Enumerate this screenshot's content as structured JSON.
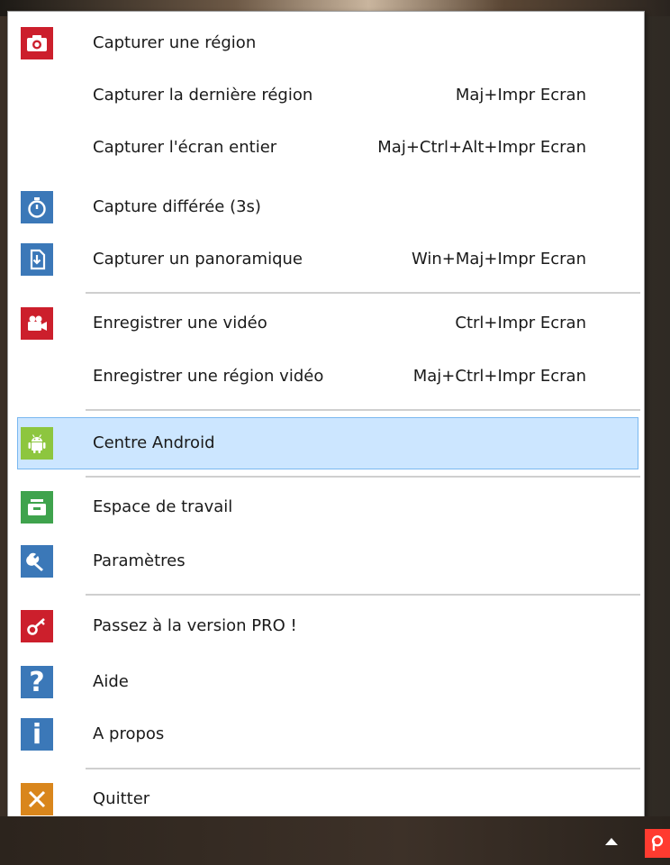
{
  "menu": {
    "items": [
      {
        "label": "Capturer une région",
        "shortcut": "",
        "icon": "camera-icon",
        "icon_bg": "#cc1f2c"
      },
      {
        "label": "Capturer la dernière région",
        "shortcut": "Maj+Impr Ecran",
        "icon": "",
        "icon_bg": ""
      },
      {
        "label": "Capturer l'écran entier",
        "shortcut": "Maj+Ctrl+Alt+Impr Ecran",
        "icon": "",
        "icon_bg": ""
      },
      {
        "label": "Capture différée (3s)",
        "shortcut": "",
        "icon": "stopwatch-icon",
        "icon_bg": "#3b78b8"
      },
      {
        "label": "Capturer un panoramique",
        "shortcut": "Win+Maj+Impr Ecran",
        "icon": "panorama-icon",
        "icon_bg": "#3b78b8"
      },
      {
        "label": "Enregistrer une vidéo",
        "shortcut": "Ctrl+Impr Ecran",
        "icon": "video-camera-icon",
        "icon_bg": "#cc1f2c"
      },
      {
        "label": "Enregistrer une région vidéo",
        "shortcut": "Maj+Ctrl+Impr Ecran",
        "icon": "",
        "icon_bg": ""
      },
      {
        "label": "Centre Android",
        "shortcut": "",
        "icon": "android-icon",
        "icon_bg": "#8dc63f",
        "selected": true
      },
      {
        "label": "Espace de travail",
        "shortcut": "",
        "icon": "workspace-icon",
        "icon_bg": "#3fa34d"
      },
      {
        "label": "Paramètres",
        "shortcut": "",
        "icon": "wrench-icon",
        "icon_bg": "#3b78b8"
      },
      {
        "label": "Passez à la version PRO !",
        "shortcut": "",
        "icon": "key-icon",
        "icon_bg": "#cc1f2c"
      },
      {
        "label": "Aide",
        "shortcut": "",
        "icon": "question-icon",
        "icon_bg": "#3b78b8"
      },
      {
        "label": "A propos",
        "shortcut": "",
        "icon": "info-icon",
        "icon_bg": "#3b78b8"
      },
      {
        "label": "Quitter",
        "shortcut": "",
        "icon": "close-icon",
        "icon_bg": "#d9861c"
      }
    ]
  },
  "taskbar": {
    "tray_app_icon": "picpick-icon",
    "tray_app_color": "#ff3b30",
    "tray_arrow_icon": "show-hidden-icons-arrow"
  }
}
